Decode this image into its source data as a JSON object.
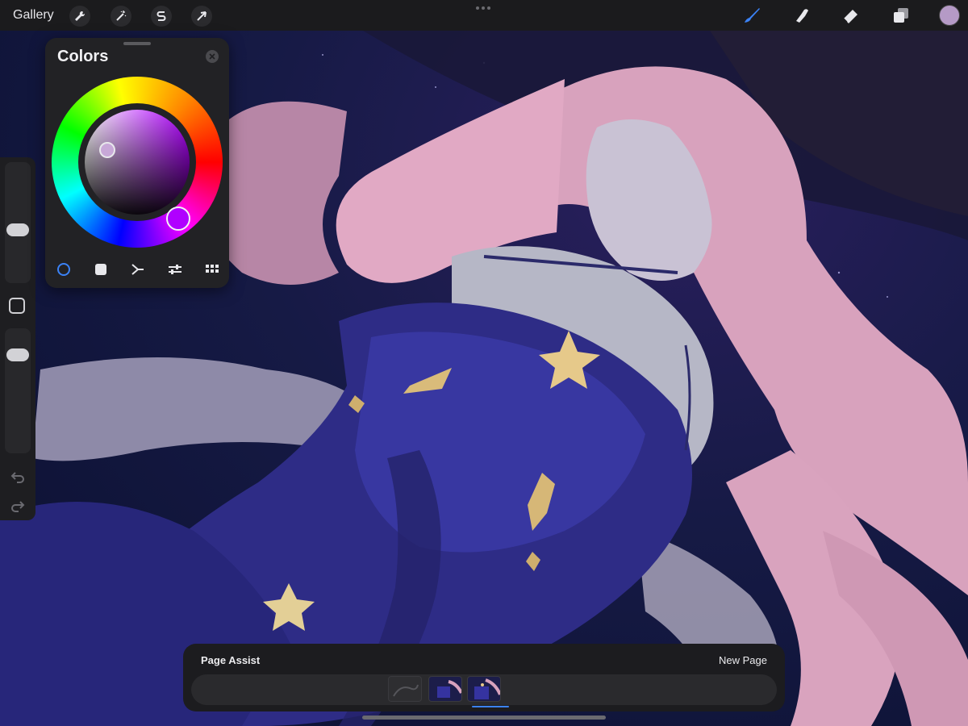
{
  "topbar": {
    "gallery_label": "Gallery",
    "left_tools": [
      {
        "name": "actions",
        "icon": "wrench-icon"
      },
      {
        "name": "adjustments",
        "icon": "magic-wand-icon"
      },
      {
        "name": "selection",
        "icon": "selection-s-icon"
      },
      {
        "name": "transform",
        "icon": "arrow-cursor-icon"
      }
    ],
    "right_tools": [
      {
        "name": "brush",
        "icon": "brush-icon",
        "active": true
      },
      {
        "name": "smudge",
        "icon": "smudge-finger-icon",
        "active": false
      },
      {
        "name": "eraser",
        "icon": "eraser-icon",
        "active": false
      },
      {
        "name": "layers",
        "icon": "layers-icon",
        "active": false
      }
    ],
    "current_color": "#b59ac6"
  },
  "sidebar": {
    "brush_size_level": 0.4,
    "opacity_level": 0.85,
    "modify_icon": "square-outline-icon",
    "undo_icon": "undo-arrow-icon",
    "redo_icon": "redo-arrow-icon"
  },
  "colors_panel": {
    "title": "Colors",
    "close_icon": "close-x-icon",
    "selected_hue_color": "#b000ff",
    "tabs": [
      {
        "name": "disc",
        "icon": "disc-circle-icon",
        "active": true
      },
      {
        "name": "classic",
        "icon": "classic-square-icon",
        "active": false
      },
      {
        "name": "harmony",
        "icon": "harmony-icon",
        "active": false
      },
      {
        "name": "value",
        "icon": "sliders-icon",
        "active": false
      },
      {
        "name": "palettes",
        "icon": "palette-grid-icon",
        "active": false
      }
    ]
  },
  "page_assist": {
    "title": "Page Assist",
    "new_page_label": "New Page",
    "pages": [
      {
        "name": "page-1",
        "active": false
      },
      {
        "name": "page-2",
        "active": false
      },
      {
        "name": "page-3",
        "active": true
      }
    ]
  },
  "colors": {
    "accent_blue": "#3b82f6",
    "panel_bg": "#222225",
    "topbar_bg": "#1b1b1d"
  }
}
